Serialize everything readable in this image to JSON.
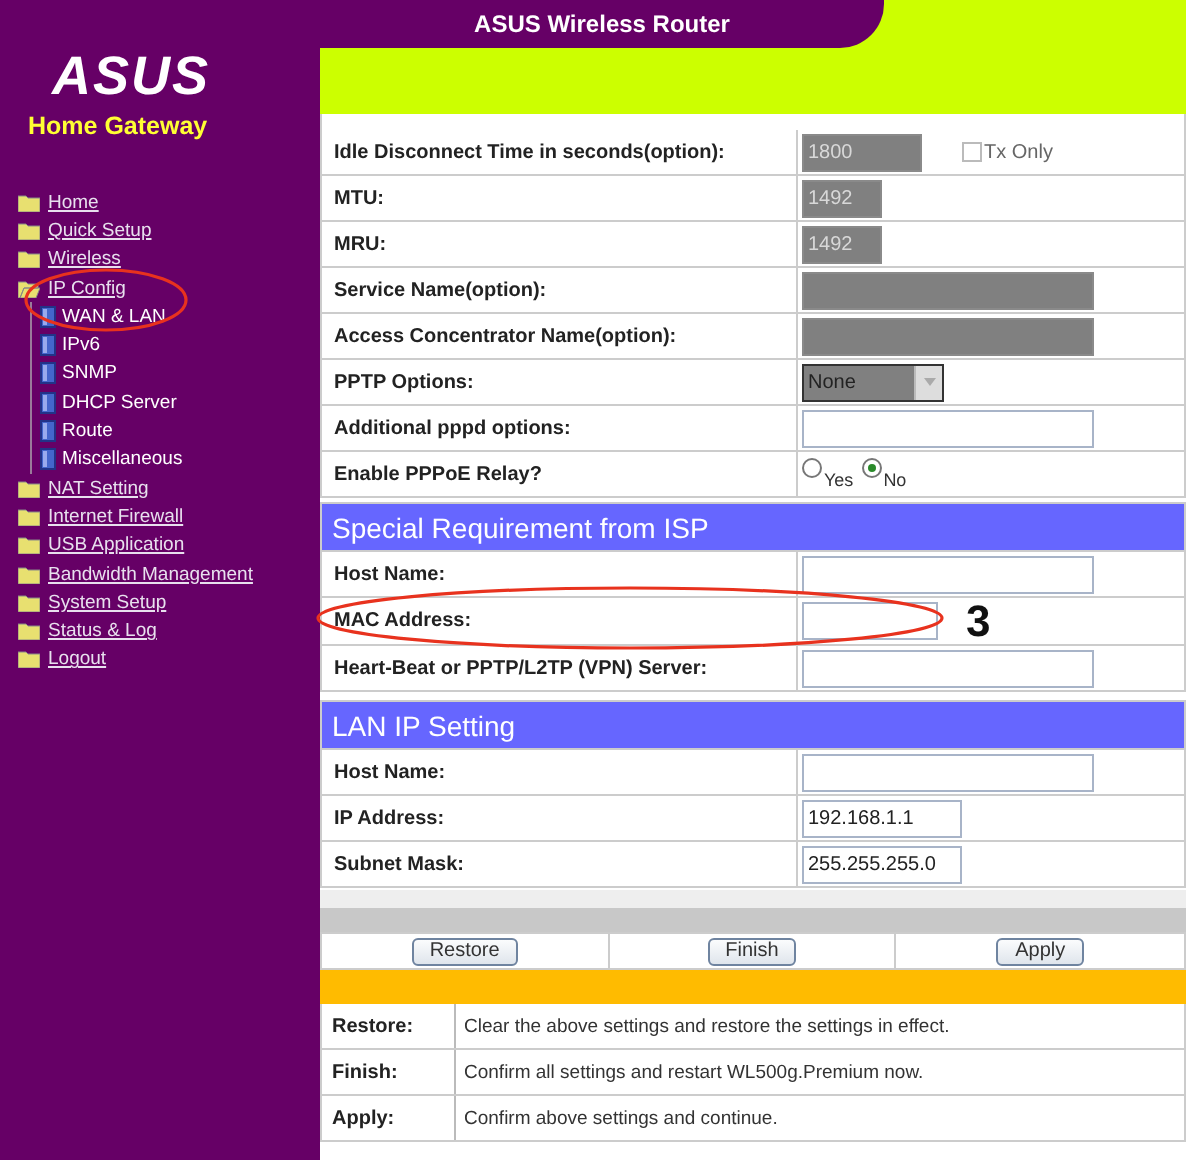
{
  "sidebar": {
    "logo": "ASUS",
    "subtitle": "Home Gateway",
    "items": [
      {
        "label": "Home",
        "expanded": false,
        "circled": false
      },
      {
        "label": "Quick Setup",
        "expanded": false,
        "circled": false
      },
      {
        "label": "Wireless",
        "expanded": false,
        "circled": false
      },
      {
        "label": "IP Config",
        "expanded": true,
        "circled": true,
        "children": [
          {
            "label": "WAN & LAN"
          },
          {
            "label": "IPv6"
          },
          {
            "label": "SNMP"
          },
          {
            "label": "DHCP Server"
          },
          {
            "label": "Route"
          },
          {
            "label": "Miscellaneous"
          }
        ]
      },
      {
        "label": "NAT Setting",
        "expanded": false,
        "circled": false
      },
      {
        "label": "Internet Firewall",
        "expanded": false,
        "circled": false
      },
      {
        "label": "USB Application",
        "expanded": false,
        "circled": false
      },
      {
        "label": "Bandwidth Management",
        "expanded": false,
        "circled": false
      },
      {
        "label": "System Setup",
        "expanded": false,
        "circled": false
      },
      {
        "label": "Status & Log",
        "expanded": false,
        "circled": false
      },
      {
        "label": "Logout",
        "expanded": false,
        "circled": false
      }
    ]
  },
  "header": {
    "title": "ASUS Wireless Router"
  },
  "wan_rows": [
    {
      "label": "Idle Disconnect Time in seconds(option):",
      "kind": "text",
      "value": "1800",
      "disabled": true,
      "checkbox": {
        "label": "Tx Only",
        "checked": false
      }
    },
    {
      "label": "MTU:",
      "kind": "text",
      "value": "1492",
      "disabled": true
    },
    {
      "label": "MRU:",
      "kind": "text",
      "value": "1492",
      "disabled": true
    },
    {
      "label": "Service Name(option):",
      "kind": "text",
      "disabled": true
    },
    {
      "label": "Access Concentrator Name(option):",
      "kind": "text",
      "disabled": true
    },
    {
      "label": "PPTP Options:",
      "kind": "select",
      "value": "None",
      "disabled": true
    },
    {
      "label": "Additional pppd options:",
      "kind": "text",
      "disabled": false
    },
    {
      "label": "Enable PPPoE Relay?",
      "kind": "radio",
      "options": [
        {
          "label": "Yes",
          "selected": false
        },
        {
          "label": "No",
          "selected": true
        }
      ]
    }
  ],
  "sections": [
    {
      "title": "Special Requirement from ISP",
      "rows": [
        {
          "label": "Host Name:",
          "kind": "text",
          "disabled": false,
          "circled": false
        },
        {
          "label": "MAC Address:",
          "kind": "text",
          "disabled": false,
          "circled": true,
          "note": "3"
        },
        {
          "label": "Heart-Beat or PPTP/L2TP (VPN) Server:",
          "kind": "text",
          "disabled": false,
          "circled": false
        }
      ]
    },
    {
      "title": "LAN IP Setting",
      "rows": [
        {
          "label": "Host Name:",
          "kind": "text",
          "disabled": false,
          "circled": false
        },
        {
          "label": "IP Address:",
          "kind": "text",
          "value": "192.168.1.1",
          "disabled": false,
          "circled": false
        },
        {
          "label": "Subnet Mask:",
          "kind": "text",
          "value": "255.255.255.0",
          "disabled": false,
          "circled": false
        }
      ]
    }
  ],
  "buttons": [
    "Restore",
    "Finish",
    "Apply"
  ],
  "help": [
    {
      "term": "Restore:",
      "text": "Clear the above settings and restore the settings in effect."
    },
    {
      "term": "Finish:",
      "text": "Confirm all settings and restart WL500g.Premium now."
    },
    {
      "term": "Apply:",
      "text": "Confirm above settings and continue."
    }
  ]
}
